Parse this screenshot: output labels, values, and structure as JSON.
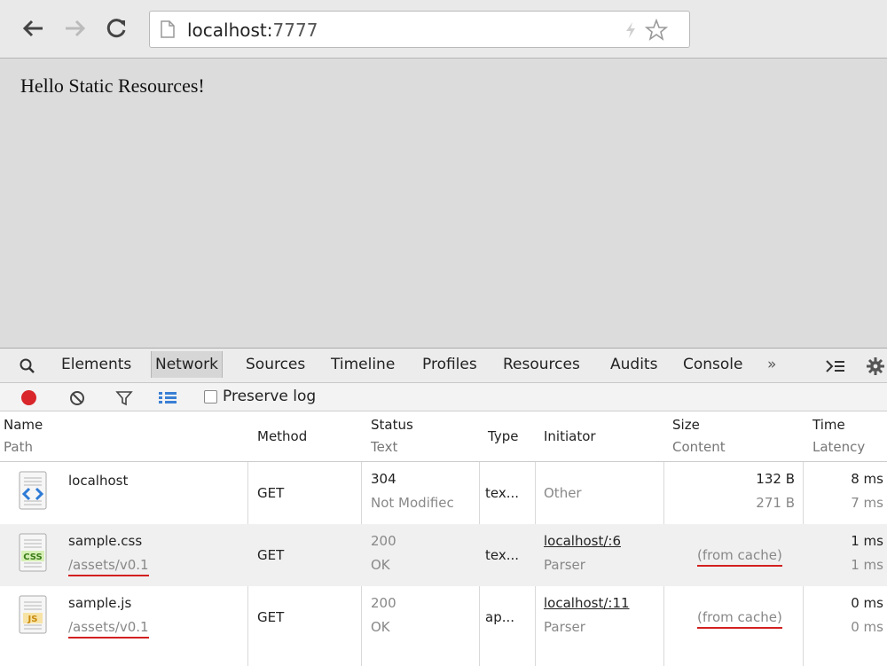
{
  "browser": {
    "url_host": "localhost:",
    "url_port": "7777"
  },
  "page": {
    "text": "Hello Static Resources!"
  },
  "devtools": {
    "tabs": [
      "Elements",
      "Network",
      "Sources",
      "Timeline",
      "Profiles",
      "Resources",
      "Audits",
      "Console"
    ],
    "more_tabs": "»",
    "active_tab": "Network",
    "preserve_log": "Preserve log",
    "columns": {
      "name": {
        "h1": "Name",
        "h2": "Path"
      },
      "method": {
        "h1": "Method"
      },
      "status": {
        "h1": "Status",
        "h2": "Text"
      },
      "type": {
        "h1": "Type"
      },
      "initiator": {
        "h1": "Initiator"
      },
      "size": {
        "h1": "Size",
        "h2": "Content"
      },
      "time": {
        "h1": "Time",
        "h2": "Latency"
      }
    },
    "requests": [
      {
        "name": "localhost",
        "path": "",
        "icon": "html-file-icon",
        "method": "GET",
        "status": "304",
        "status_text": "Not Modifiec",
        "type": "tex...",
        "initiator": "Other",
        "initiator_sub": "",
        "size": "132 B",
        "content": "271 B",
        "time": "8 ms",
        "latency": "7 ms"
      },
      {
        "name": "sample.css",
        "path": "/assets/v0.1",
        "icon": "css-file-icon",
        "method": "GET",
        "status": "200",
        "status_text": "OK",
        "type": "tex...",
        "initiator": "localhost/:6",
        "initiator_sub": "Parser",
        "size": "(from cache)",
        "content": "",
        "time": "1 ms",
        "latency": "1 ms"
      },
      {
        "name": "sample.js",
        "path": "/assets/v0.1",
        "icon": "js-file-icon",
        "method": "GET",
        "status": "200",
        "status_text": "OK",
        "type": "ap...",
        "initiator": "localhost/:11",
        "initiator_sub": "Parser",
        "size": "(from cache)",
        "content": "",
        "time": "0 ms",
        "latency": "0 ms"
      }
    ]
  }
}
